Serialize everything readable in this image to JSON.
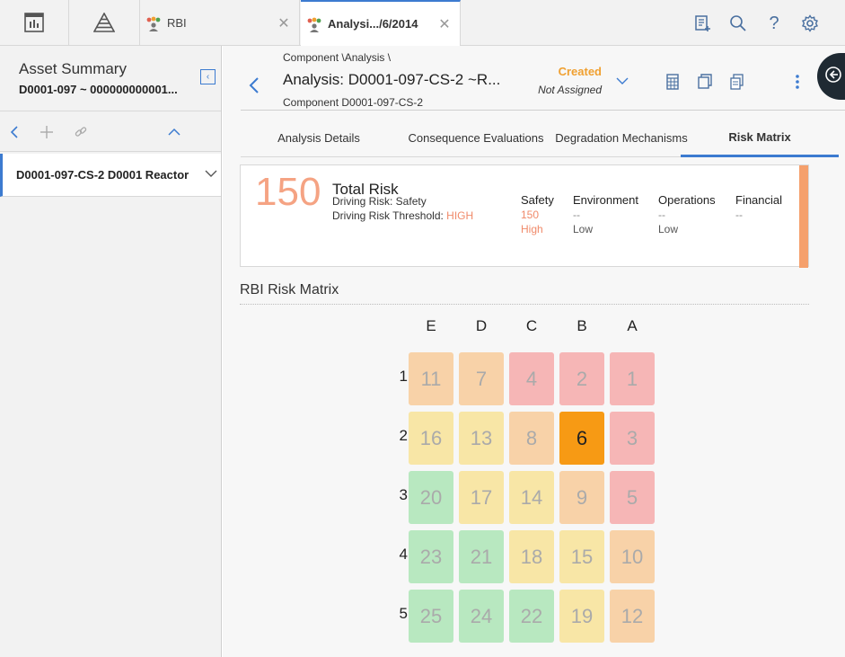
{
  "topbar": {
    "home_icon": "dashboard-icon",
    "nav_icon": "pyramid-icon",
    "tabs": [
      {
        "label": "RBI",
        "icon": "people-group-icon",
        "active": false
      },
      {
        "label": "Analysi.../6/2014",
        "icon": "people-group-icon",
        "active": true
      }
    ],
    "right_icons": [
      "new-record-icon",
      "search-icon",
      "help-icon",
      "settings-icon"
    ]
  },
  "sidebar": {
    "title": "Asset Summary",
    "subtitle": "D0001-097 ~ 000000000001...",
    "item_label": "D0001-097-CS-2 D0001 Reactor"
  },
  "header": {
    "breadcrumb": "Component \\Analysis \\",
    "title": "Analysis: D0001-097-CS-2 ~R...",
    "subtitle": "Component D0001-097-CS-2",
    "state": "Created",
    "assignee": "Not Assigned"
  },
  "tabs": [
    {
      "label": "Analysis Details",
      "active": false
    },
    {
      "label": "Consequence Evaluations",
      "active": false
    },
    {
      "label": "Degradation Mechanisms",
      "active": false
    },
    {
      "label": "Risk Matrix",
      "active": true
    }
  ],
  "risk": {
    "value": "150",
    "total_label": "Total Risk",
    "driving_label": "Driving Risk: Safety",
    "threshold_label": "Driving Risk Threshold: ",
    "threshold_value": "HIGH",
    "categories": [
      {
        "name": "Safety",
        "value": "150",
        "level": "High",
        "hot": true
      },
      {
        "name": "Environment",
        "value": "--",
        "level": "Low",
        "hot": false
      },
      {
        "name": "Operations",
        "value": "--",
        "level": "Low",
        "hot": false
      },
      {
        "name": "Financial",
        "value": "--",
        "level": "",
        "hot": false
      }
    ]
  },
  "matrix": {
    "title": "RBI Risk Matrix",
    "columns": [
      "E",
      "D",
      "C",
      "B",
      "A"
    ],
    "rows": [
      "1",
      "2",
      "3",
      "4",
      "5"
    ],
    "cells": [
      [
        "11",
        "7",
        "4",
        "2",
        "1"
      ],
      [
        "16",
        "13",
        "8",
        "6",
        "3"
      ],
      [
        "20",
        "17",
        "14",
        "9",
        "5"
      ],
      [
        "23",
        "21",
        "18",
        "15",
        "10"
      ],
      [
        "25",
        "24",
        "22",
        "19",
        "12"
      ]
    ],
    "colors": [
      [
        "#f8d2a8",
        "#f8d2a8",
        "#f6b6b6",
        "#f6b6b6",
        "#f6b6b6"
      ],
      [
        "#f8e6a6",
        "#f8e6a6",
        "#f8d2a8",
        "#f79a14",
        "#f6b6b6"
      ],
      [
        "#b8e8c0",
        "#f8e6a6",
        "#f8e6a6",
        "#f8d2a8",
        "#f6b6b6"
      ],
      [
        "#b8e8c0",
        "#b8e8c0",
        "#f8e6a6",
        "#f8e6a6",
        "#f8d2a8"
      ],
      [
        "#b8e8c0",
        "#b8e8c0",
        "#b8e8c0",
        "#f8e6a6",
        "#f8d2a8"
      ]
    ],
    "selected": "6"
  }
}
